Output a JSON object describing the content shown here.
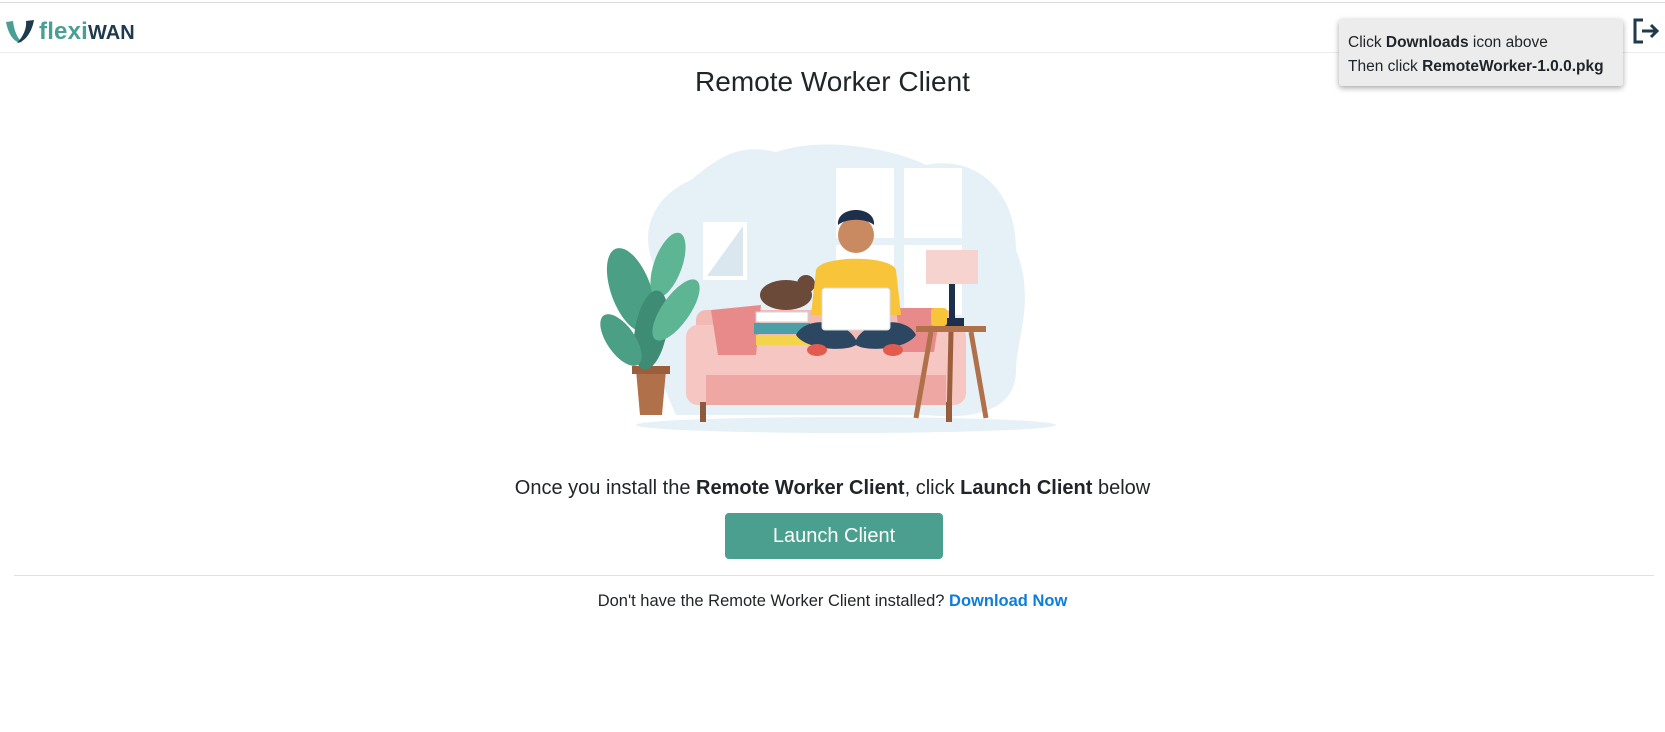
{
  "brand": {
    "name_part1": "flexi",
    "name_part2": "WAN",
    "primary_color": "#4a9f94",
    "dark_color": "#1e3a4c"
  },
  "header": {
    "logout_icon": "logout-icon"
  },
  "tooltip": {
    "line1_prefix": "Click ",
    "line1_bold": "Downloads",
    "line1_suffix": " icon above",
    "line2_prefix": "Then click ",
    "line2_bold": "RemoteWorker-1.0.0.pkg"
  },
  "main": {
    "title": "Remote Worker Client",
    "illustration": "person-on-sofa-with-laptop-illustration",
    "instruction": {
      "part1": "Once you install the ",
      "bold1": "Remote Worker Client",
      "part2": ", click ",
      "bold2": "Launch Client",
      "part3": " below"
    },
    "launch_button_label": "Launch Client",
    "launch_button_color": "#4a9f8f"
  },
  "footer": {
    "question": "Don't have the Remote Worker Client installed? ",
    "download_link": "Download Now",
    "link_color": "#0d7ddb"
  }
}
